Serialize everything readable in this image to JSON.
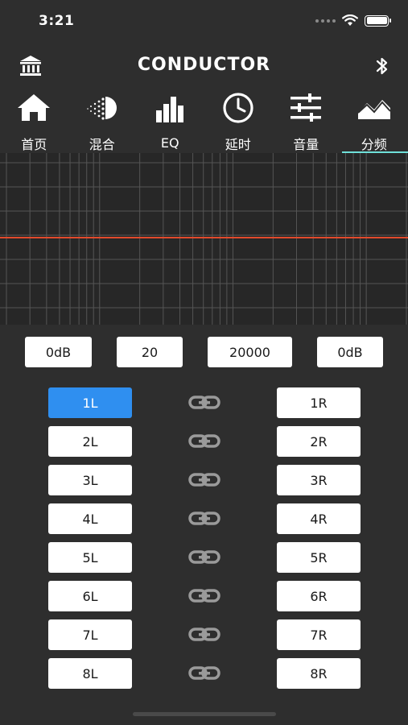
{
  "status_bar": {
    "time": "3:21"
  },
  "nav": {
    "title": "CONDUCTOR"
  },
  "tabs": [
    {
      "label": "首页",
      "icon": "home-icon"
    },
    {
      "label": "混合",
      "icon": "mix-icon"
    },
    {
      "label": "EQ",
      "icon": "eq-bars-icon"
    },
    {
      "label": "延时",
      "icon": "clock-icon"
    },
    {
      "label": "音量",
      "icon": "sliders-icon"
    },
    {
      "label": "分频",
      "icon": "crossover-icon",
      "active": true
    }
  ],
  "crossover": {
    "low_gain": "0dB",
    "low_freq": "20",
    "high_freq": "20000",
    "high_gain": "0dB"
  },
  "channels": {
    "left": [
      "1L",
      "2L",
      "3L",
      "4L",
      "5L",
      "6L",
      "7L",
      "8L"
    ],
    "right": [
      "1R",
      "2R",
      "3R",
      "4R",
      "5R",
      "6R",
      "7R",
      "8R"
    ],
    "selected": "1L"
  },
  "colors": {
    "background": "#2e2e2e",
    "graph_bg": "#272727",
    "response_line": "#e24a2c",
    "active_tab_underline": "#6fe0d9",
    "selected_channel": "#2f8ff0"
  }
}
